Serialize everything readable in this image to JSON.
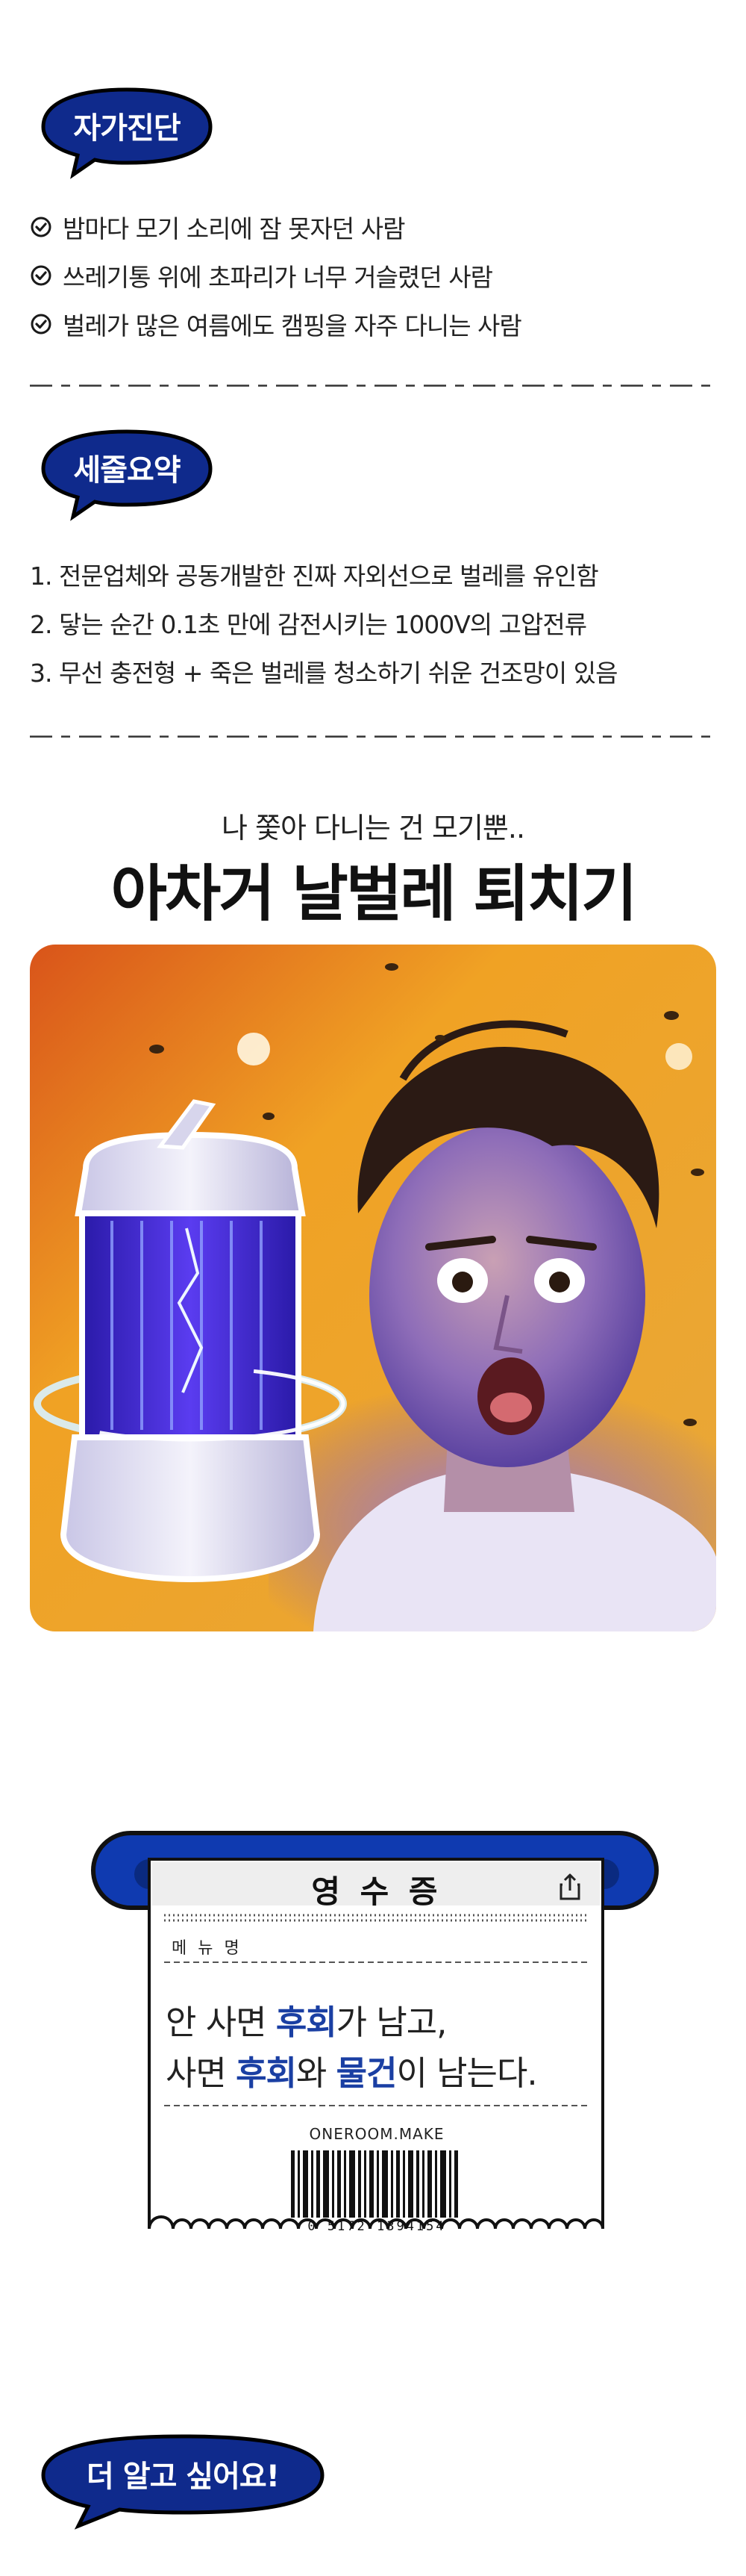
{
  "section1": {
    "bubble_label": "자가진단",
    "items": [
      "밤마다 모기 소리에 잠 못자던 사람",
      "쓰레기통 위에 초파리가 너무 거슬렸던 사람",
      "벌레가 많은 여름에도 캠핑을 자주 다니는 사람"
    ]
  },
  "section2": {
    "bubble_label": "세줄요약",
    "items": [
      "1. 전문업체와 공동개발한 진짜 자외선으로 벌레를 유인함",
      "2. 닿는 순간 0.1초 만에 감전시키는 1000V의 고압전류",
      "3. 무선 충전형 + 죽은 벌레를 청소하기 쉬운 건조망이 있음"
    ]
  },
  "hero": {
    "subtitle": "나 쫓아 다니는 건 모기뿐..",
    "title": "아차거 날벌레 퇴치기"
  },
  "receipt": {
    "title": "영 수 증",
    "menu_label": "메 뉴 명",
    "line1_a": "안 사면 ",
    "line1_b": "후회",
    "line1_c": "가 남고,",
    "line2_a": "사면 ",
    "line2_b": "후회",
    "line2_c": "와 ",
    "line2_d": "물건",
    "line2_e": "이 남는다.",
    "brand": "ONEROOM.MAKE",
    "barcode_number": "0 5172 1394154"
  },
  "footer": {
    "bubble_label": "더 알고 싶어요!"
  },
  "colors": {
    "bubble_navy": "#0f2a8c",
    "accent_blue": "#1a3fa3",
    "receipt_bar": "#0f3ab0"
  }
}
